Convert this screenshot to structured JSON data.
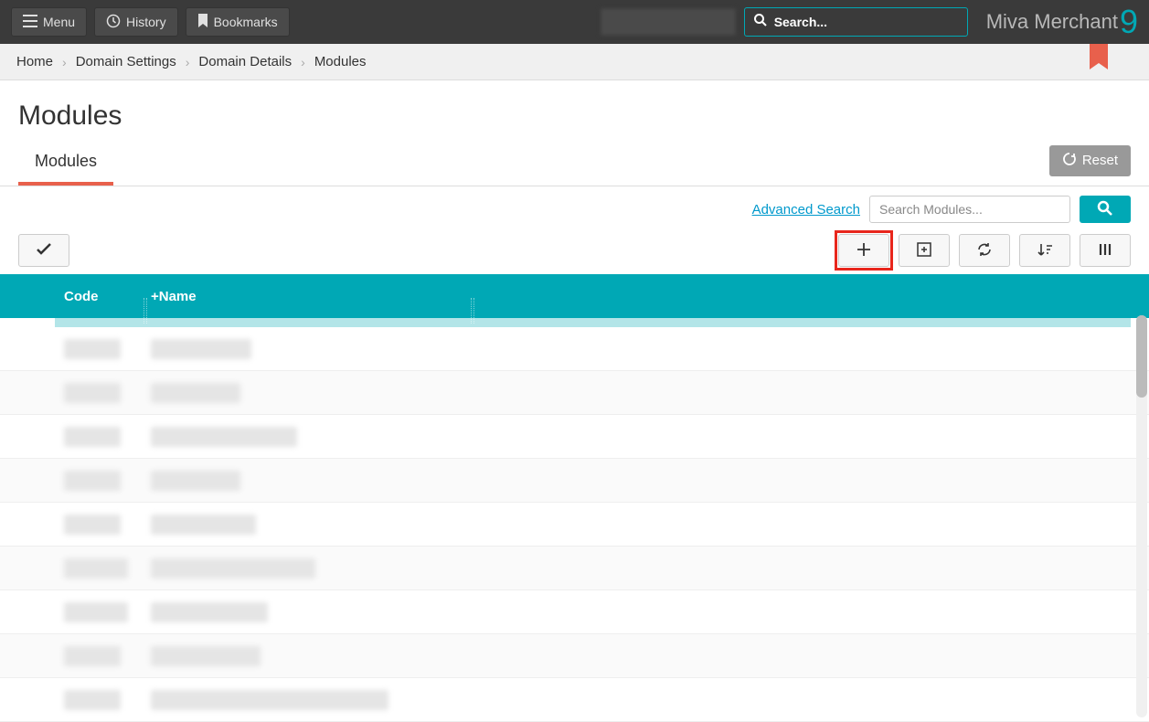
{
  "topbar": {
    "menu_label": "Menu",
    "history_label": "History",
    "bookmarks_label": "Bookmarks",
    "search_placeholder": "Search..."
  },
  "logo": {
    "text": "Miva Merchant",
    "version": "9"
  },
  "breadcrumbs": [
    {
      "label": "Home"
    },
    {
      "label": "Domain Settings"
    },
    {
      "label": "Domain Details"
    },
    {
      "label": "Modules"
    }
  ],
  "page": {
    "title": "Modules"
  },
  "tabs": {
    "active": "Modules"
  },
  "reset_label": "Reset",
  "search": {
    "advanced_label": "Advanced Search",
    "modules_placeholder": "Search Modules..."
  },
  "columns": {
    "code": "Code",
    "name": "+Name"
  },
  "rows": [
    {
      "code_w": 62,
      "name_w": 110
    },
    {
      "code_w": 62,
      "name_w": 98
    },
    {
      "code_w": 62,
      "name_w": 160
    },
    {
      "code_w": 62,
      "name_w": 98
    },
    {
      "code_w": 62,
      "name_w": 115
    },
    {
      "code_w": 70,
      "name_w": 180
    },
    {
      "code_w": 70,
      "name_w": 128
    },
    {
      "code_w": 62,
      "name_w": 120
    },
    {
      "code_w": 62,
      "name_w": 260
    }
  ]
}
